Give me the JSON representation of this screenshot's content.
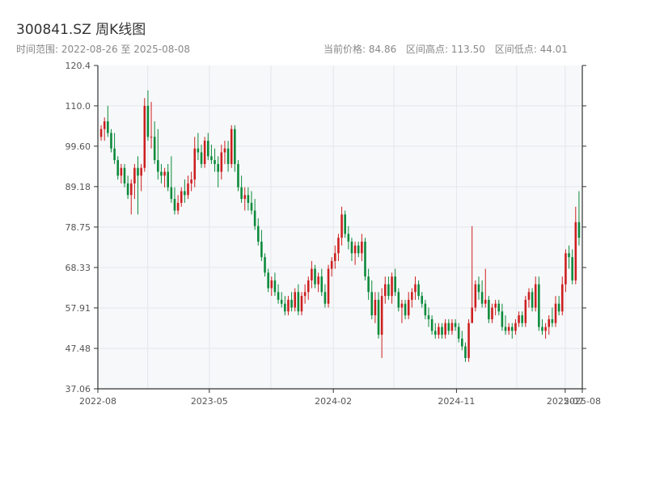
{
  "header": {
    "title": "300841.SZ 周K线图",
    "range_label": "时间范围: 2022-08-26 至 2025-08-08",
    "current_price": "当前价格: 84.86",
    "range_high": "区间高点: 113.50",
    "range_low": "区间低点: 44.01"
  },
  "colors": {
    "up": "#cc1f1f",
    "down": "#0b8a3a",
    "plot_bg": "#f7f8fa",
    "grid": "#e4e6ea"
  },
  "chart_data": {
    "type": "candlestick",
    "title": "300841.SZ 周K线图",
    "xlabel": "",
    "ylabel": "",
    "ylim": [
      37.06,
      120.4
    ],
    "y_ticks": [
      "120.4",
      "110.0",
      "99.60",
      "89.18",
      "78.75",
      "68.33",
      "57.91",
      "47.48",
      "37.06"
    ],
    "x_range": [
      "2022-08-26",
      "2025-08-08"
    ],
    "x_ticks": [
      {
        "date": "2022-08-26",
        "label": "2022-08"
      },
      {
        "date": "2023-05-01",
        "label": "2023-05"
      },
      {
        "date": "2024-02-01",
        "label": "2024-02"
      },
      {
        "date": "2024-11-01",
        "label": "2024-11"
      },
      {
        "date": "2025-07-01",
        "label": "2025-07"
      },
      {
        "date": "2025-08-08",
        "label": "2025-08"
      }
    ],
    "grid": true,
    "candles": [
      [
        102,
        105,
        101,
        104
      ],
      [
        104,
        107,
        101,
        106
      ],
      [
        106,
        110,
        102,
        103
      ],
      [
        103,
        104,
        98,
        99
      ],
      [
        99,
        103,
        95,
        96
      ],
      [
        96,
        97,
        91,
        92
      ],
      [
        92,
        95,
        90,
        94
      ],
      [
        94,
        95,
        89,
        90
      ],
      [
        90,
        92,
        86,
        87
      ],
      [
        87,
        91,
        82,
        90
      ],
      [
        90,
        95,
        86,
        94
      ],
      [
        94,
        97,
        82,
        92
      ],
      [
        92,
        95,
        88,
        94
      ],
      [
        94,
        112,
        93,
        110
      ],
      [
        110,
        114,
        101,
        102
      ],
      [
        102,
        111,
        99,
        102
      ],
      [
        102,
        106,
        95,
        96
      ],
      [
        96,
        104,
        91,
        93
      ],
      [
        93,
        95,
        90,
        92
      ],
      [
        92,
        94,
        89,
        93
      ],
      [
        93,
        95,
        88,
        89
      ],
      [
        89,
        97,
        85,
        86
      ],
      [
        86,
        89,
        82,
        83
      ],
      [
        83,
        87,
        82,
        85
      ],
      [
        85,
        89,
        84,
        88
      ],
      [
        88,
        91,
        85,
        87
      ],
      [
        87,
        92,
        86,
        90
      ],
      [
        90,
        93,
        88,
        91
      ],
      [
        91,
        102,
        89,
        99
      ],
      [
        99,
        103,
        96,
        98
      ],
      [
        98,
        100,
        94,
        95
      ],
      [
        95,
        102,
        94,
        101
      ],
      [
        101,
        103,
        96,
        97
      ],
      [
        97,
        100,
        95,
        96
      ],
      [
        96,
        99,
        93,
        95
      ],
      [
        95,
        97,
        89,
        93
      ],
      [
        93,
        100,
        91,
        98
      ],
      [
        98,
        101,
        95,
        99
      ],
      [
        99,
        101,
        93,
        95
      ],
      [
        95,
        105,
        94,
        104
      ],
      [
        104,
        105,
        93,
        95
      ],
      [
        95,
        96,
        88,
        89
      ],
      [
        89,
        92,
        85,
        86
      ],
      [
        86,
        89,
        83,
        87
      ],
      [
        87,
        89,
        83,
        85
      ],
      [
        85,
        88,
        82,
        83
      ],
      [
        83,
        86,
        78,
        79
      ],
      [
        79,
        81,
        74,
        75
      ],
      [
        75,
        78,
        70,
        71
      ],
      [
        71,
        72,
        66,
        67
      ],
      [
        67,
        68,
        62,
        63
      ],
      [
        63,
        66,
        61,
        65
      ],
      [
        65,
        67,
        61,
        62
      ],
      [
        62,
        64,
        59,
        60
      ],
      [
        60,
        62,
        58,
        59
      ],
      [
        59,
        61,
        56,
        57
      ],
      [
        57,
        61,
        56,
        60
      ],
      [
        60,
        62,
        57,
        58
      ],
      [
        58,
        63,
        57,
        62
      ],
      [
        62,
        64,
        56,
        57
      ],
      [
        57,
        62,
        56,
        61
      ],
      [
        61,
        64,
        59,
        62
      ],
      [
        62,
        66,
        60,
        65
      ],
      [
        65,
        70,
        63,
        68
      ],
      [
        68,
        69,
        63,
        64
      ],
      [
        64,
        67,
        62,
        66
      ],
      [
        66,
        68,
        61,
        62
      ],
      [
        62,
        64,
        58,
        59
      ],
      [
        59,
        69,
        58,
        68
      ],
      [
        68,
        71,
        66,
        70
      ],
      [
        70,
        74,
        68,
        72
      ],
      [
        72,
        77,
        70,
        76
      ],
      [
        76,
        84,
        74,
        82
      ],
      [
        82,
        83,
        76,
        77
      ],
      [
        77,
        79,
        73,
        75
      ],
      [
        75,
        76,
        70,
        72
      ],
      [
        72,
        75,
        69,
        74
      ],
      [
        74,
        75,
        71,
        72
      ],
      [
        72,
        77,
        70,
        75
      ],
      [
        75,
        76,
        65,
        66
      ],
      [
        66,
        68,
        60,
        62
      ],
      [
        62,
        65,
        55,
        56
      ],
      [
        56,
        62,
        54,
        60
      ],
      [
        60,
        62,
        50,
        51
      ],
      [
        51,
        63,
        45,
        61
      ],
      [
        61,
        66,
        59,
        64
      ],
      [
        64,
        66,
        60,
        61
      ],
      [
        61,
        67,
        59,
        66
      ],
      [
        66,
        68,
        61,
        62
      ],
      [
        62,
        63,
        57,
        58
      ],
      [
        58,
        60,
        54,
        59
      ],
      [
        59,
        60,
        55,
        56
      ],
      [
        56,
        62,
        55,
        60
      ],
      [
        60,
        63,
        58,
        62
      ],
      [
        62,
        66,
        60,
        64
      ],
      [
        64,
        65,
        60,
        61
      ],
      [
        61,
        62,
        58,
        59
      ],
      [
        59,
        60,
        55,
        56
      ],
      [
        56,
        58,
        53,
        55
      ],
      [
        55,
        56,
        51,
        52
      ],
      [
        52,
        54,
        50,
        51
      ],
      [
        51,
        54,
        50,
        53
      ],
      [
        53,
        54,
        50,
        51
      ],
      [
        51,
        55,
        50,
        54
      ],
      [
        54,
        55,
        51,
        52
      ],
      [
        52,
        55,
        51,
        54
      ],
      [
        54,
        55,
        52,
        53
      ],
      [
        53,
        54,
        49,
        50
      ],
      [
        50,
        52,
        47,
        48
      ],
      [
        48,
        49,
        44,
        45
      ],
      [
        45,
        55,
        44,
        54
      ],
      [
        54,
        79,
        57,
        58
      ],
      [
        58,
        65,
        57,
        64
      ],
      [
        64,
        66,
        60,
        62
      ],
      [
        62,
        65,
        58,
        59
      ],
      [
        59,
        68,
        58,
        60
      ],
      [
        60,
        61,
        54,
        55
      ],
      [
        55,
        59,
        54,
        58
      ],
      [
        58,
        60,
        56,
        59
      ],
      [
        59,
        60,
        56,
        57
      ],
      [
        57,
        59,
        52,
        53
      ],
      [
        53,
        56,
        51,
        52
      ],
      [
        52,
        54,
        51,
        53
      ],
      [
        53,
        54,
        50,
        52
      ],
      [
        52,
        55,
        51,
        54
      ],
      [
        54,
        57,
        53,
        56
      ],
      [
        56,
        57,
        53,
        54
      ],
      [
        54,
        61,
        53,
        60
      ],
      [
        60,
        63,
        58,
        62
      ],
      [
        62,
        63,
        57,
        58
      ],
      [
        58,
        66,
        57,
        64
      ],
      [
        64,
        66,
        52,
        53
      ],
      [
        53,
        55,
        51,
        52
      ],
      [
        52,
        54,
        50,
        53
      ],
      [
        53,
        56,
        51,
        55
      ],
      [
        55,
        58,
        53,
        54
      ],
      [
        54,
        61,
        53,
        59
      ],
      [
        59,
        61,
        56,
        57
      ],
      [
        57,
        66,
        56,
        64
      ],
      [
        64,
        73,
        62,
        72
      ],
      [
        72,
        74,
        68,
        71
      ],
      [
        71,
        73,
        64,
        65
      ],
      [
        65,
        84,
        64,
        80
      ],
      [
        80,
        88,
        74,
        76
      ]
    ]
  }
}
